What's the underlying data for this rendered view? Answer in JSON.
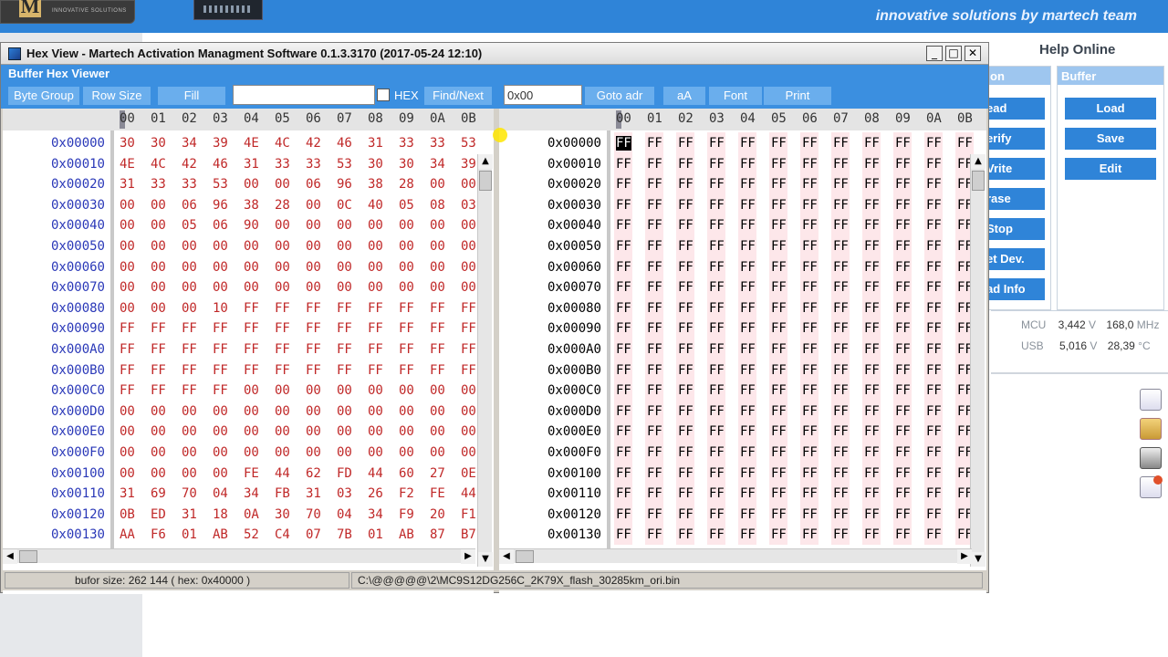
{
  "app": {
    "tagline": "innovative solutions by martech team",
    "logo_letter": "M",
    "logo_sub": "INNOVATIVE SOLUTIONS",
    "help_online": "Help Online",
    "operation_panel_title": "on",
    "operation_buttons": [
      "ead",
      "erify",
      "Vrite",
      "rase",
      "Stop",
      "et Dev.",
      "ad Info"
    ],
    "buffer_panel_title": "Buffer",
    "buffer_buttons": [
      "Load",
      "Save",
      "Edit"
    ],
    "stats": [
      {
        "label": "MCU",
        "value1": "3,442",
        "unit1": "V",
        "value2": "168,0",
        "unit2": "MHz"
      },
      {
        "label": "USB",
        "value1": "5,016",
        "unit1": "V",
        "value2": "28,39",
        "unit2": "°C"
      }
    ],
    "side_icons": [
      "log-icon",
      "folder-icon",
      "printer-icon",
      "log-add-icon"
    ]
  },
  "window": {
    "title": "Hex View - Martech Activation Managment Software 0.1.3.3170   (2017-05-24 12:10)",
    "subtitle": "Buffer Hex Viewer",
    "controls": {
      "minimize": "_",
      "maximize": "□",
      "close": "✕"
    }
  },
  "toolbar": {
    "byte_group": "Byte Group",
    "row_size": "Row Size",
    "fill": "Fill",
    "search_value": "",
    "hex_label": "HEX",
    "find_next": "Find/Next",
    "goto_value": "0x00",
    "goto_adr": "Goto adr",
    "case": "aA",
    "font": "Font",
    "print": "Print"
  },
  "hex": {
    "columns": [
      "00",
      "01",
      "02",
      "03",
      "04",
      "05",
      "06",
      "07",
      "08",
      "09",
      "0A",
      "0B"
    ],
    "addresses": [
      "0x00000",
      "0x00010",
      "0x00020",
      "0x00030",
      "0x00040",
      "0x00050",
      "0x00060",
      "0x00070",
      "0x00080",
      "0x00090",
      "0x000A0",
      "0x000B0",
      "0x000C0",
      "0x000D0",
      "0x000E0",
      "0x000F0",
      "0x00100",
      "0x00110",
      "0x00120",
      "0x00130"
    ],
    "left_rows": [
      [
        "30",
        "30",
        "34",
        "39",
        "4E",
        "4C",
        "42",
        "46",
        "31",
        "33",
        "33",
        "53"
      ],
      [
        "4E",
        "4C",
        "42",
        "46",
        "31",
        "33",
        "33",
        "53",
        "30",
        "30",
        "34",
        "39"
      ],
      [
        "31",
        "33",
        "33",
        "53",
        "00",
        "00",
        "06",
        "96",
        "38",
        "28",
        "00",
        "00"
      ],
      [
        "00",
        "00",
        "06",
        "96",
        "38",
        "28",
        "00",
        "0C",
        "40",
        "05",
        "08",
        "03"
      ],
      [
        "00",
        "00",
        "05",
        "06",
        "90",
        "00",
        "00",
        "00",
        "00",
        "00",
        "00",
        "00"
      ],
      [
        "00",
        "00",
        "00",
        "00",
        "00",
        "00",
        "00",
        "00",
        "00",
        "00",
        "00",
        "00"
      ],
      [
        "00",
        "00",
        "00",
        "00",
        "00",
        "00",
        "00",
        "00",
        "00",
        "00",
        "00",
        "00"
      ],
      [
        "00",
        "00",
        "00",
        "00",
        "00",
        "00",
        "00",
        "00",
        "00",
        "00",
        "00",
        "00"
      ],
      [
        "00",
        "00",
        "00",
        "10",
        "FF",
        "FF",
        "FF",
        "FF",
        "FF",
        "FF",
        "FF",
        "FF"
      ],
      [
        "FF",
        "FF",
        "FF",
        "FF",
        "FF",
        "FF",
        "FF",
        "FF",
        "FF",
        "FF",
        "FF",
        "FF"
      ],
      [
        "FF",
        "FF",
        "FF",
        "FF",
        "FF",
        "FF",
        "FF",
        "FF",
        "FF",
        "FF",
        "FF",
        "FF"
      ],
      [
        "FF",
        "FF",
        "FF",
        "FF",
        "FF",
        "FF",
        "FF",
        "FF",
        "FF",
        "FF",
        "FF",
        "FF"
      ],
      [
        "FF",
        "FF",
        "FF",
        "FF",
        "00",
        "00",
        "00",
        "00",
        "00",
        "00",
        "00",
        "00"
      ],
      [
        "00",
        "00",
        "00",
        "00",
        "00",
        "00",
        "00",
        "00",
        "00",
        "00",
        "00",
        "00"
      ],
      [
        "00",
        "00",
        "00",
        "00",
        "00",
        "00",
        "00",
        "00",
        "00",
        "00",
        "00",
        "00"
      ],
      [
        "00",
        "00",
        "00",
        "00",
        "00",
        "00",
        "00",
        "00",
        "00",
        "00",
        "00",
        "00"
      ],
      [
        "00",
        "00",
        "00",
        "00",
        "FE",
        "44",
        "62",
        "FD",
        "44",
        "60",
        "27",
        "0E"
      ],
      [
        "31",
        "69",
        "70",
        "04",
        "34",
        "FB",
        "31",
        "03",
        "26",
        "F2",
        "FE",
        "44"
      ],
      [
        "0B",
        "ED",
        "31",
        "18",
        "0A",
        "30",
        "70",
        "04",
        "34",
        "F9",
        "20",
        "F1"
      ],
      [
        "AA",
        "F6",
        "01",
        "AB",
        "52",
        "C4",
        "07",
        "7B",
        "01",
        "AB",
        "87",
        "B7"
      ]
    ],
    "right_fill": "FF",
    "selected_byte": "FF"
  },
  "status": {
    "buffer_size": "bufor size: 262 144 ( hex: 0x40000 )",
    "file_path": "C:\\@@@@@\\2\\MC9S12DG256C_2K79X_flash_30285km_ori.bin"
  },
  "colors": {
    "accent": "#3b8fe0",
    "button": "#6aaeed",
    "hex_red": "#c02828",
    "stripe": "#fde7ea"
  }
}
